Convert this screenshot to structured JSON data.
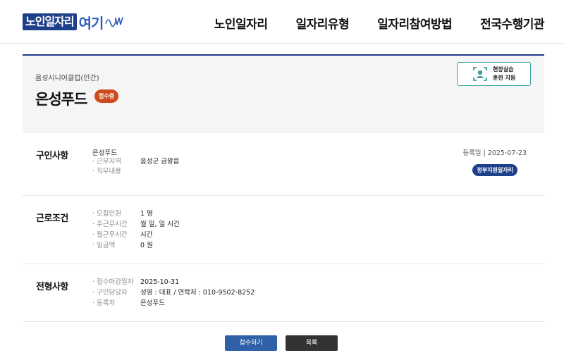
{
  "header": {
    "logo_part1": "노인일자리",
    "logo_part2": "여기",
    "nav": [
      "노인일자리",
      "일자리유형",
      "일자리참여방법",
      "전국수행기관"
    ]
  },
  "job": {
    "org": "음성시니어클럽(민간)",
    "title": "은성푸드",
    "status": "접수중",
    "training_badge": [
      "현장실습",
      "훈련 지원"
    ]
  },
  "recruit": {
    "title": "구인사항",
    "company": "은성푸드",
    "rows": [
      {
        "label": "· 근무지역",
        "value": "음성군 금왕읍"
      },
      {
        "label": "· 직무내용",
        "value": ""
      }
    ],
    "reg_date": "등록일  |  2025-07-23",
    "gov_badge": "정부지원일자리"
  },
  "conditions": {
    "title": "근로조건",
    "rows": [
      {
        "label": "· 모집인원",
        "value": "1 명"
      },
      {
        "label": "· 주근무시간",
        "value": "월 일, 일 시간"
      },
      {
        "label": "· 월근무시간",
        "value": "시간"
      },
      {
        "label": "· 임금액",
        "value": "0 원"
      }
    ]
  },
  "selection": {
    "title": "전형사항",
    "rows": [
      {
        "label": "· 접수마감일자",
        "value": "2025-10-31"
      },
      {
        "label": "· 구인담당자",
        "value": "성명 : 대표 / 연락처 : 010-9502-8252"
      },
      {
        "label": "· 등록자",
        "value": "은성푸드"
      }
    ]
  },
  "buttons": {
    "apply": "접수하기",
    "list": "목록"
  },
  "colors": {
    "brand_navy": "#1e3f8a",
    "status_orange": "#cf4b1f",
    "teal": "#3aa39e",
    "apply_blue": "#3060a8",
    "list_dark": "#333333"
  }
}
